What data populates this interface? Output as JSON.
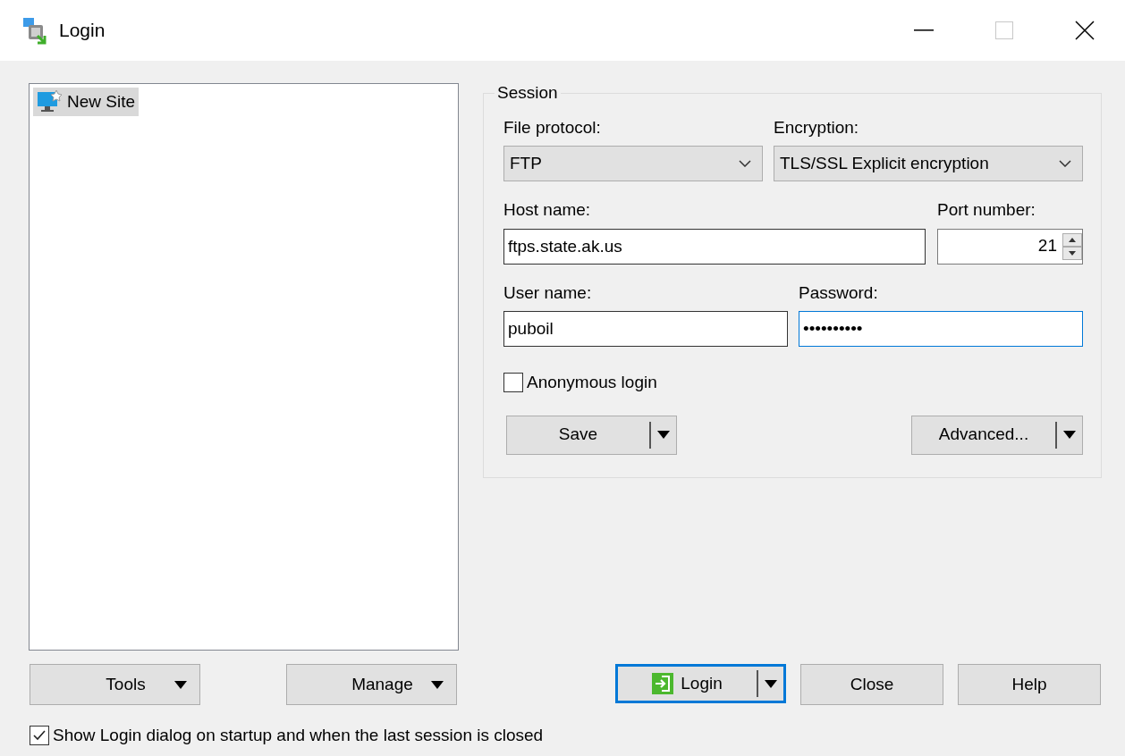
{
  "window": {
    "title": "Login"
  },
  "sites": [
    {
      "label": "New Site",
      "selected": true
    }
  ],
  "session": {
    "legend": "Session",
    "file_protocol": {
      "label": "File protocol:",
      "value": "FTP"
    },
    "encryption": {
      "label": "Encryption:",
      "value": "TLS/SSL Explicit encryption"
    },
    "host": {
      "label": "Host name:",
      "value": "ftps.state.ak.us"
    },
    "port": {
      "label": "Port number:",
      "value": "21"
    },
    "user": {
      "label": "User name:",
      "value": "puboil",
      "focused": false
    },
    "password": {
      "label": "Password:",
      "value": "••••••••••",
      "focused": true
    },
    "anonymous": {
      "label": "Anonymous login",
      "checked": false
    },
    "save_button": {
      "label": "Save"
    },
    "advanced_button": {
      "label": "Advanced..."
    }
  },
  "site_buttons": [
    {
      "label": "Tools"
    },
    {
      "label": "Manage"
    }
  ],
  "dialog_buttons": [
    {
      "label": "Login",
      "kind": "split",
      "default": true
    },
    {
      "label": "Close",
      "kind": "plain",
      "default": false
    },
    {
      "label": "Help",
      "kind": "plain",
      "default": false
    }
  ],
  "show_login": {
    "label": "Show Login dialog on startup and when the last session is closed",
    "checked": true
  }
}
